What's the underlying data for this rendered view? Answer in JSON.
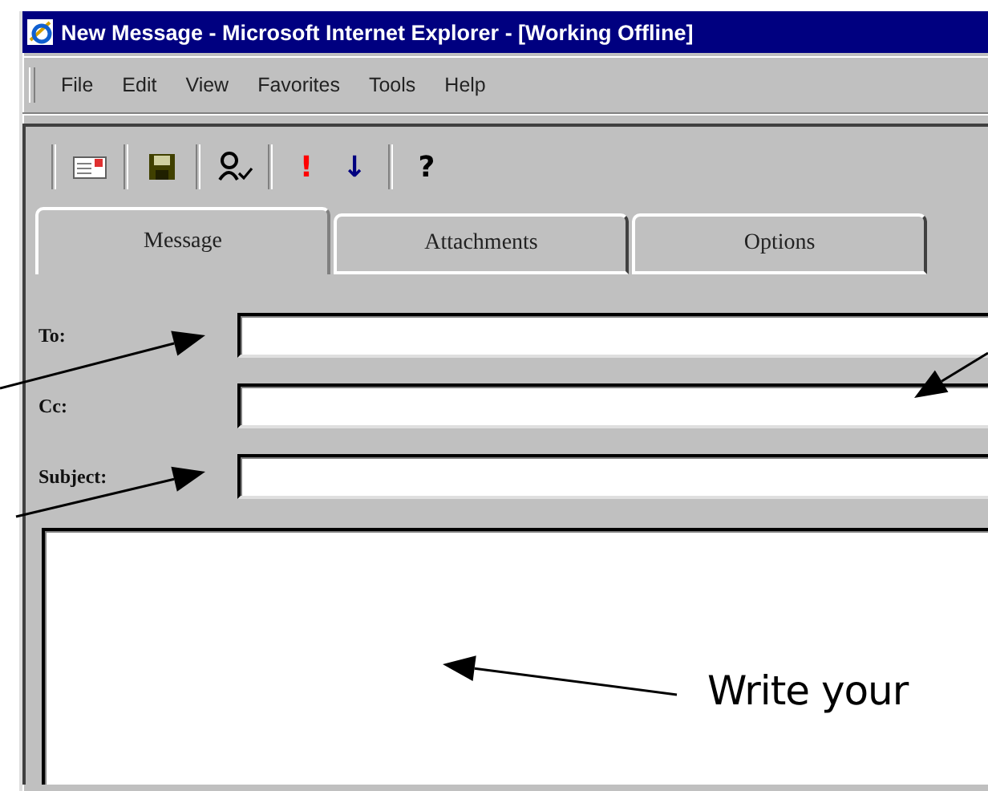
{
  "window": {
    "title": "New Message - Microsoft Internet Explorer - [Working Offline]"
  },
  "menu": [
    {
      "label": "File"
    },
    {
      "label": "Edit"
    },
    {
      "label": "View"
    },
    {
      "label": "Favorites"
    },
    {
      "label": "Tools"
    },
    {
      "label": "Help"
    }
  ],
  "toolbar": [
    {
      "kind": "envelope"
    },
    {
      "kind": "disk"
    },
    {
      "kind": "person"
    },
    {
      "kind": "glyph",
      "glyph": "!",
      "color": "#ff0000"
    },
    {
      "kind": "glyph",
      "glyph": "↓",
      "color": "#000080"
    },
    {
      "kind": "glyph",
      "glyph": "?",
      "color": "#000000"
    }
  ],
  "tabs": [
    {
      "label": "Message",
      "selected": true
    },
    {
      "label": "Attachments",
      "selected": false
    },
    {
      "label": "Options",
      "selected": false
    }
  ],
  "fields": [
    {
      "label": "To:"
    },
    {
      "label": "Cc:"
    },
    {
      "label": "Subject:"
    }
  ],
  "annotation": {
    "text": "Write your"
  }
}
